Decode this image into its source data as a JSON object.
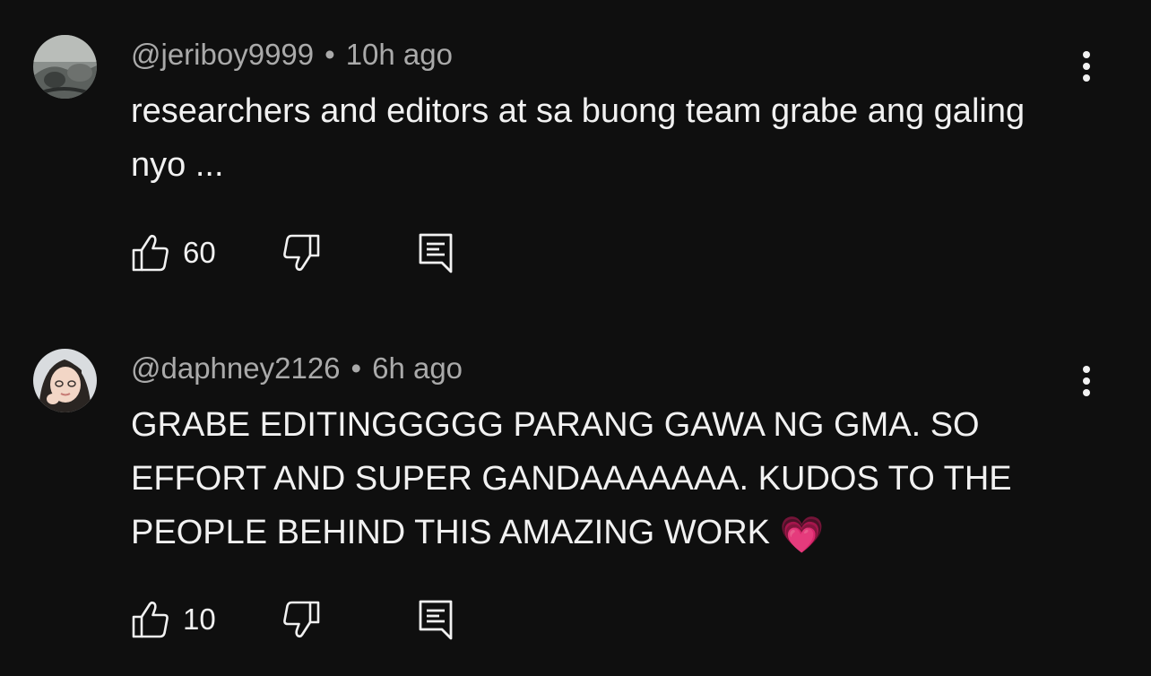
{
  "comments": [
    {
      "author": "@jeriboy9999",
      "separator": "•",
      "time": "10h ago",
      "text": "researchers and editors at sa buong team grabe ang galing nyo ...",
      "likes": "60"
    },
    {
      "author": "@daphney2126",
      "separator": "•",
      "time": "6h ago",
      "text": "GRABE EDITINGGGGG PARANG GAWA NG GMA. SO EFFORT AND SUPER GANDAAAAAAA. KUDOS TO THE PEOPLE BEHIND THIS AMAZING WORK",
      "emoji": "💗",
      "likes": "10"
    }
  ],
  "colors": {
    "background": "#0f0f0f",
    "text_primary": "#f1f1f1",
    "text_secondary": "#aaaaaa"
  },
  "icons": {
    "like": "thumbs-up-icon",
    "dislike": "thumbs-down-icon",
    "reply": "reply-icon",
    "more": "more-vertical-icon"
  }
}
